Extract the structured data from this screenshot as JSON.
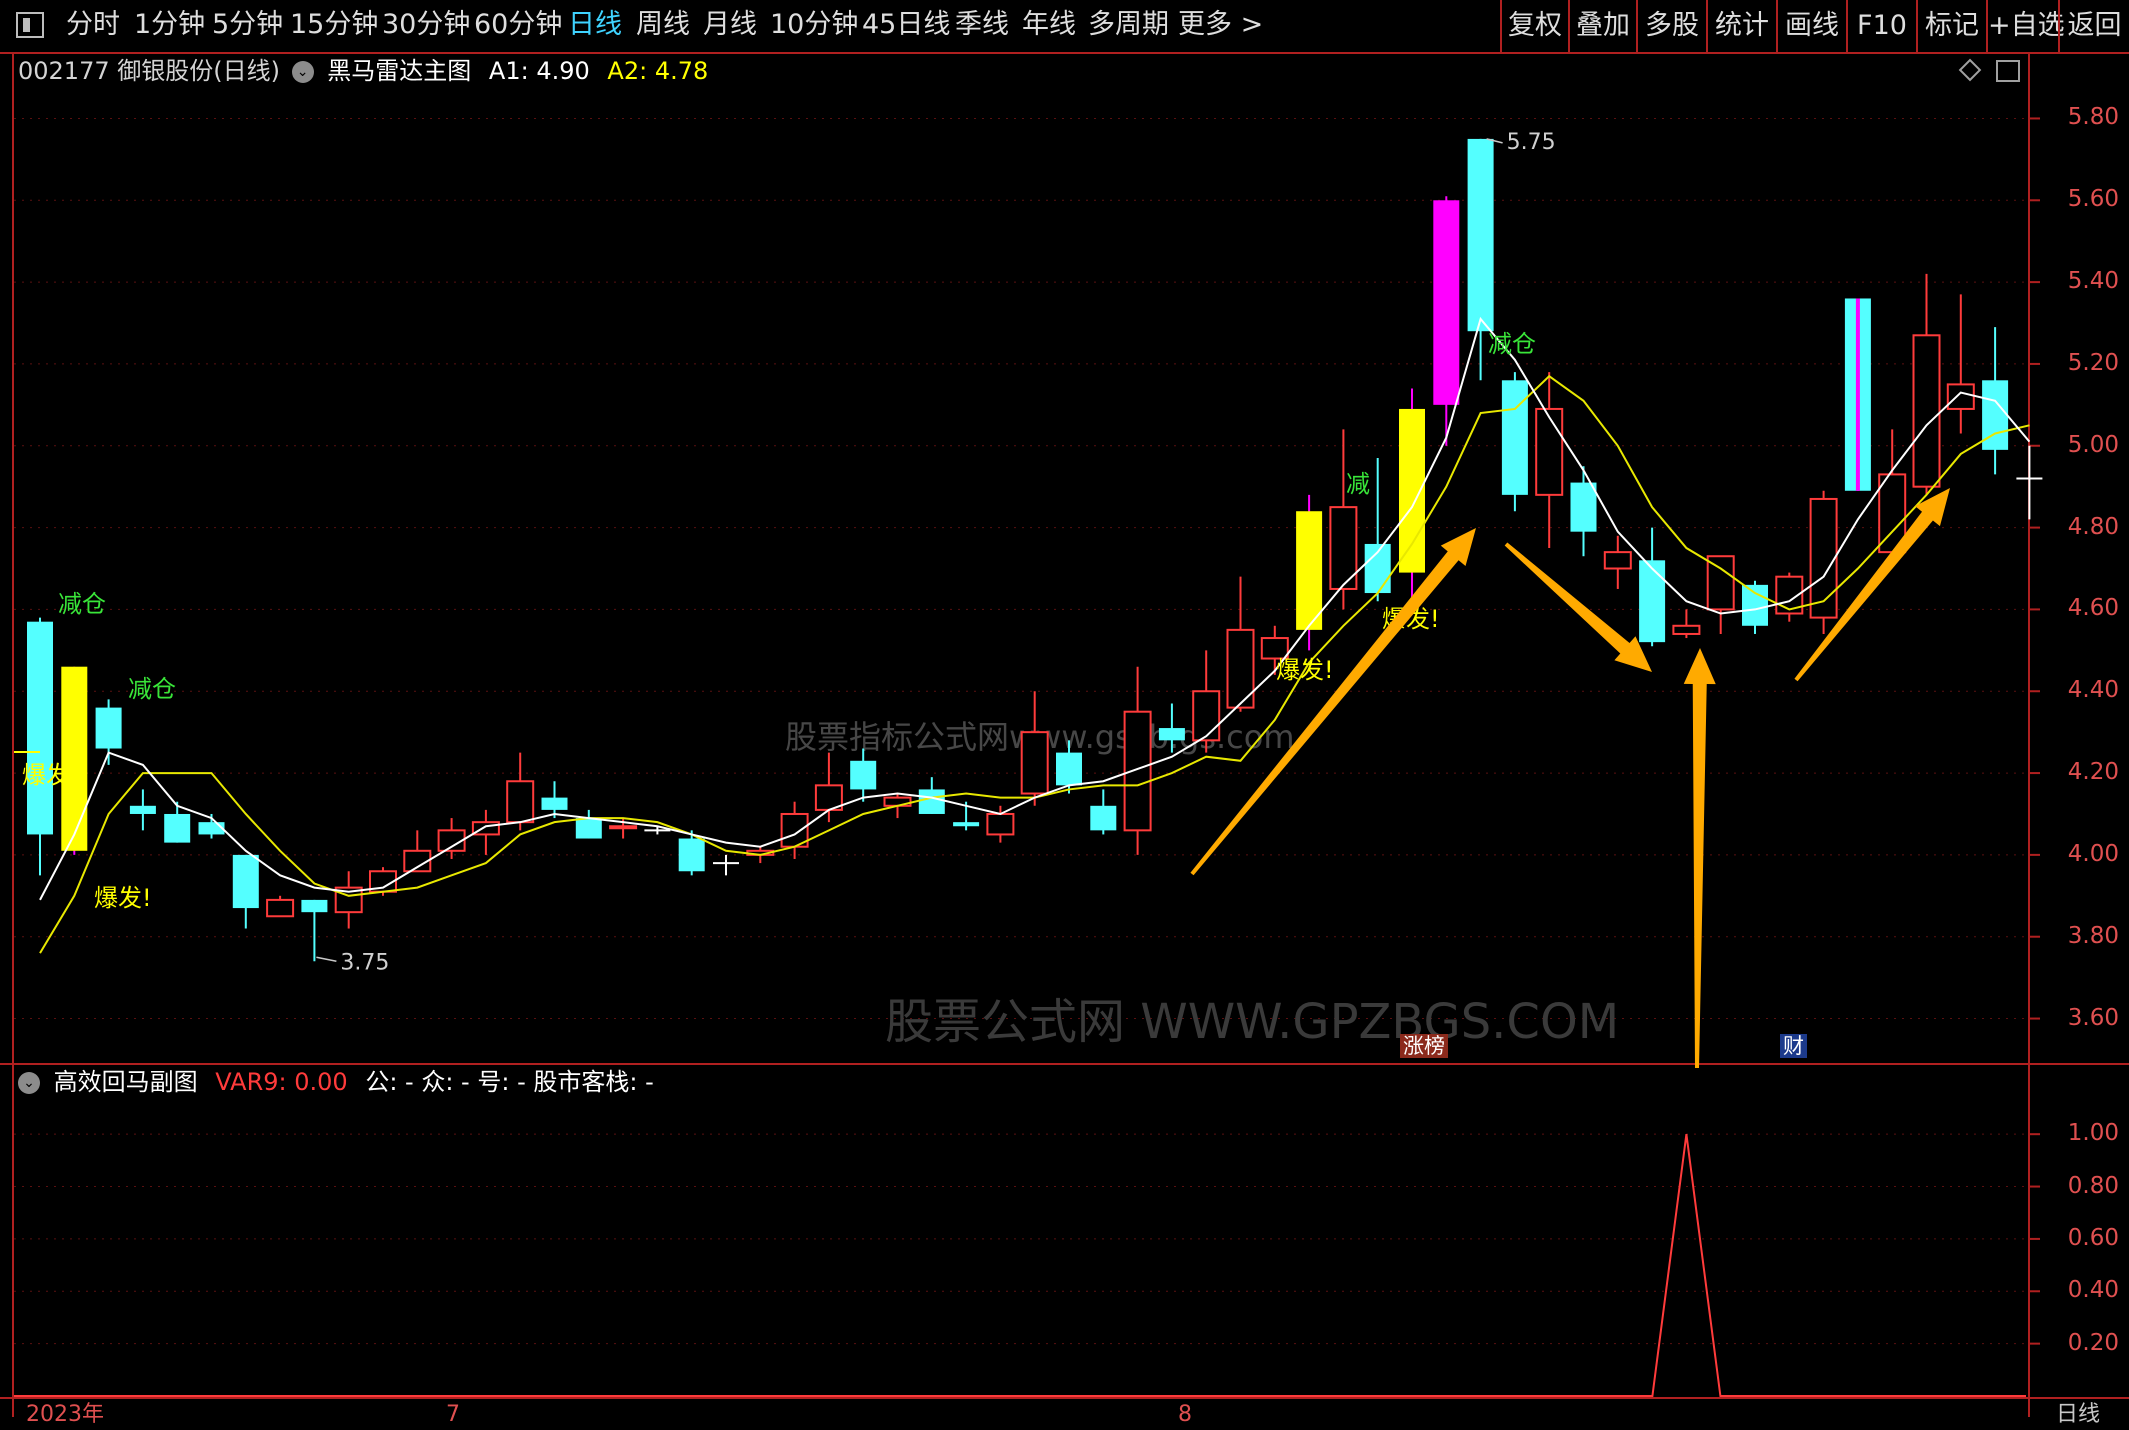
{
  "toolbar": {
    "periods": [
      "分时",
      "1分钟",
      "5分钟",
      "15分钟",
      "30分钟",
      "60分钟",
      "日线",
      "周线",
      "月线",
      "10分钟",
      "45日线",
      "季线",
      "年线",
      "多周期",
      "更多 >"
    ],
    "active_period": "日线",
    "right_tools": [
      "复权",
      "叠加",
      "多股",
      "统计",
      "画线",
      "F10",
      "标记",
      "+自选",
      "返回"
    ]
  },
  "main_panel": {
    "stock": "002177 御银股份(日线)",
    "indicator": "黑马雷达主图",
    "a1_label": "A1:",
    "a1_value": "4.90",
    "a2_label": "A2:",
    "a2_value": "4.78",
    "y_ticks": [
      "5.80",
      "5.60",
      "5.40",
      "5.20",
      "5.00",
      "4.80",
      "4.60",
      "4.40",
      "4.20",
      "4.00",
      "3.80",
      "3.60"
    ],
    "high_label": "5.75",
    "low_label": "3.75",
    "signals": {
      "reduce": "减仓",
      "reduce_short": "减",
      "burst": "爆发!"
    },
    "badges": [
      "涨榜",
      "财"
    ],
    "watermarks": {
      "big": "股票公式网 WWW.GPZBGS.COM",
      "mid": "股票指标公式网www.gszb.gs.com"
    }
  },
  "sub_panel": {
    "indicator": "高效回马副图",
    "var9_label": "VAR9:",
    "var9_value": "0.00",
    "fields": "公: -  众: -  号: -  股市客栈: -",
    "y_ticks": [
      "1.00",
      "0.80",
      "0.60",
      "0.40",
      "0.20"
    ]
  },
  "bottom": {
    "year": "2023年",
    "month_7": "7",
    "month_8": "8",
    "period_tag": "日线"
  },
  "colors": {
    "up": "#ff3b3b",
    "down": "#54ffff",
    "signal_yellow": "#ffff00",
    "signal_magenta": "#ff00ff",
    "ma_white": "#ffffff",
    "ma_yellow": "#e8e800",
    "arrow": "#ffaa00",
    "axis": "#e05050"
  },
  "chart_data": {
    "type": "candlestick",
    "title": "002177 御银股份(日线)",
    "y_range": [
      3.55,
      5.85
    ],
    "candles": [
      {
        "o": 4.05,
        "h": 4.58,
        "l": 3.95,
        "c": 4.57,
        "kind": "down"
      },
      {
        "o": 4.46,
        "h": 4.46,
        "l": 4.0,
        "c": 4.01,
        "kind": "yellow"
      },
      {
        "o": 4.36,
        "h": 4.38,
        "l": 4.22,
        "c": 4.26,
        "kind": "down"
      },
      {
        "o": 4.12,
        "h": 4.16,
        "l": 4.06,
        "c": 4.1,
        "kind": "down"
      },
      {
        "o": 4.1,
        "h": 4.13,
        "l": 4.03,
        "c": 4.03,
        "kind": "down"
      },
      {
        "o": 4.08,
        "h": 4.1,
        "l": 4.04,
        "c": 4.05,
        "kind": "down"
      },
      {
        "o": 4.0,
        "h": 4.0,
        "l": 3.82,
        "c": 3.87,
        "kind": "down"
      },
      {
        "o": 3.85,
        "h": 3.9,
        "l": 3.85,
        "c": 3.89,
        "kind": "up"
      },
      {
        "o": 3.89,
        "h": 3.89,
        "l": 3.74,
        "c": 3.86,
        "kind": "down"
      },
      {
        "o": 3.86,
        "h": 3.96,
        "l": 3.82,
        "c": 3.92,
        "kind": "up"
      },
      {
        "o": 3.91,
        "h": 3.97,
        "l": 3.9,
        "c": 3.96,
        "kind": "up"
      },
      {
        "o": 3.96,
        "h": 4.06,
        "l": 3.96,
        "c": 4.01,
        "kind": "up"
      },
      {
        "o": 4.01,
        "h": 4.09,
        "l": 3.99,
        "c": 4.06,
        "kind": "up"
      },
      {
        "o": 4.05,
        "h": 4.11,
        "l": 4.0,
        "c": 4.08,
        "kind": "up"
      },
      {
        "o": 4.08,
        "h": 4.25,
        "l": 4.06,
        "c": 4.18,
        "kind": "up"
      },
      {
        "o": 4.14,
        "h": 4.18,
        "l": 4.09,
        "c": 4.11,
        "kind": "down"
      },
      {
        "o": 4.09,
        "h": 4.11,
        "l": 4.04,
        "c": 4.04,
        "kind": "down"
      },
      {
        "o": 4.07,
        "h": 4.09,
        "l": 4.04,
        "c": 4.07,
        "kind": "up"
      },
      {
        "o": 4.06,
        "h": 4.07,
        "l": 4.05,
        "c": 4.06,
        "kind": "cross"
      },
      {
        "o": 4.04,
        "h": 4.06,
        "l": 3.95,
        "c": 3.96,
        "kind": "down"
      },
      {
        "o": 3.98,
        "h": 4.0,
        "l": 3.95,
        "c": 3.98,
        "kind": "cross"
      },
      {
        "o": 4.0,
        "h": 4.02,
        "l": 3.98,
        "c": 4.01,
        "kind": "up"
      },
      {
        "o": 4.02,
        "h": 4.13,
        "l": 3.99,
        "c": 4.1,
        "kind": "up"
      },
      {
        "o": 4.11,
        "h": 4.25,
        "l": 4.08,
        "c": 4.17,
        "kind": "up"
      },
      {
        "o": 4.23,
        "h": 4.26,
        "l": 4.13,
        "c": 4.16,
        "kind": "down"
      },
      {
        "o": 4.12,
        "h": 4.15,
        "l": 4.09,
        "c": 4.14,
        "kind": "up"
      },
      {
        "o": 4.16,
        "h": 4.19,
        "l": 4.1,
        "c": 4.1,
        "kind": "down"
      },
      {
        "o": 4.08,
        "h": 4.13,
        "l": 4.06,
        "c": 4.07,
        "kind": "down"
      },
      {
        "o": 4.05,
        "h": 4.12,
        "l": 4.03,
        "c": 4.1,
        "kind": "up"
      },
      {
        "o": 4.15,
        "h": 4.4,
        "l": 4.12,
        "c": 4.3,
        "kind": "up"
      },
      {
        "o": 4.25,
        "h": 4.28,
        "l": 4.15,
        "c": 4.17,
        "kind": "down"
      },
      {
        "o": 4.12,
        "h": 4.16,
        "l": 4.05,
        "c": 4.06,
        "kind": "down"
      },
      {
        "o": 4.06,
        "h": 4.46,
        "l": 4.0,
        "c": 4.35,
        "kind": "up"
      },
      {
        "o": 4.28,
        "h": 4.37,
        "l": 4.25,
        "c": 4.31,
        "kind": "down"
      },
      {
        "o": 4.28,
        "h": 4.5,
        "l": 4.25,
        "c": 4.4,
        "kind": "up"
      },
      {
        "o": 4.36,
        "h": 4.68,
        "l": 4.35,
        "c": 4.55,
        "kind": "up"
      },
      {
        "o": 4.48,
        "h": 4.56,
        "l": 4.44,
        "c": 4.53,
        "kind": "up"
      },
      {
        "o": 4.55,
        "h": 4.88,
        "l": 4.5,
        "c": 4.84,
        "kind": "yellow"
      },
      {
        "o": 4.65,
        "h": 5.04,
        "l": 4.6,
        "c": 4.85,
        "kind": "up"
      },
      {
        "o": 4.76,
        "h": 4.97,
        "l": 4.62,
        "c": 4.64,
        "kind": "down"
      },
      {
        "o": 4.69,
        "h": 5.14,
        "l": 4.62,
        "c": 5.09,
        "kind": "yellow"
      },
      {
        "o": 5.1,
        "h": 5.61,
        "l": 5.0,
        "c": 5.6,
        "kind": "magenta"
      },
      {
        "o": 5.28,
        "h": 5.75,
        "l": 5.16,
        "c": 5.75,
        "kind": "down"
      },
      {
        "o": 5.16,
        "h": 5.18,
        "l": 4.84,
        "c": 4.88,
        "kind": "down"
      },
      {
        "o": 4.88,
        "h": 5.18,
        "l": 4.75,
        "c": 5.09,
        "kind": "up"
      },
      {
        "o": 4.91,
        "h": 4.95,
        "l": 4.73,
        "c": 4.79,
        "kind": "down"
      },
      {
        "o": 4.7,
        "h": 4.78,
        "l": 4.65,
        "c": 4.74,
        "kind": "up"
      },
      {
        "o": 4.72,
        "h": 4.8,
        "l": 4.51,
        "c": 4.52,
        "kind": "down"
      },
      {
        "o": 4.54,
        "h": 4.6,
        "l": 4.53,
        "c": 4.56,
        "kind": "up"
      },
      {
        "o": 4.6,
        "h": 4.73,
        "l": 4.54,
        "c": 4.73,
        "kind": "up"
      },
      {
        "o": 4.66,
        "h": 4.67,
        "l": 4.54,
        "c": 4.56,
        "kind": "down"
      },
      {
        "o": 4.59,
        "h": 4.69,
        "l": 4.57,
        "c": 4.68,
        "kind": "up"
      },
      {
        "o": 4.58,
        "h": 4.89,
        "l": 4.54,
        "c": 4.87,
        "kind": "up"
      },
      {
        "o": 4.89,
        "h": 5.36,
        "l": 4.89,
        "c": 5.36,
        "kind": "magenta_thin"
      },
      {
        "o": 4.74,
        "h": 5.04,
        "l": 4.72,
        "c": 4.93,
        "kind": "up"
      },
      {
        "o": 4.9,
        "h": 5.42,
        "l": 4.88,
        "c": 5.27,
        "kind": "up"
      },
      {
        "o": 5.09,
        "h": 5.37,
        "l": 5.03,
        "c": 5.15,
        "kind": "up"
      },
      {
        "o": 5.16,
        "h": 5.29,
        "l": 4.93,
        "c": 4.99,
        "kind": "down"
      },
      {
        "o": 4.92,
        "h": 5.0,
        "l": 4.82,
        "c": 4.92,
        "kind": "cross"
      }
    ],
    "ma_white": [
      3.89,
      4.05,
      4.25,
      4.22,
      4.12,
      4.09,
      4.01,
      3.95,
      3.92,
      3.91,
      3.92,
      3.97,
      4.02,
      4.07,
      4.08,
      4.1,
      4.09,
      4.08,
      4.07,
      4.05,
      4.03,
      4.02,
      4.05,
      4.11,
      4.14,
      4.15,
      4.14,
      4.12,
      4.1,
      4.14,
      4.17,
      4.18,
      4.21,
      4.24,
      4.29,
      4.37,
      4.45,
      4.56,
      4.66,
      4.74,
      4.85,
      5.02,
      5.31,
      5.21,
      5.07,
      4.94,
      4.79,
      4.7,
      4.62,
      4.59,
      4.6,
      4.62,
      4.68,
      4.82,
      4.94,
      5.05,
      5.13,
      5.11,
      5.01
    ],
    "ma_yellow": [
      3.76,
      3.9,
      4.1,
      4.2,
      4.2,
      4.2,
      4.1,
      4.01,
      3.93,
      3.9,
      3.91,
      3.92,
      3.95,
      3.98,
      4.05,
      4.08,
      4.09,
      4.09,
      4.08,
      4.05,
      4.01,
      4.0,
      4.02,
      4.06,
      4.1,
      4.12,
      4.14,
      4.15,
      4.14,
      4.14,
      4.16,
      4.17,
      4.17,
      4.2,
      4.24,
      4.23,
      4.33,
      4.47,
      4.56,
      4.64,
      4.76,
      4.9,
      5.08,
      5.09,
      5.17,
      5.11,
      5.0,
      4.85,
      4.75,
      4.7,
      4.64,
      4.6,
      4.62,
      4.7,
      4.79,
      4.88,
      4.98,
      5.03,
      5.05
    ],
    "sub_series": {
      "name": "VAR9",
      "y_range": [
        0,
        1.1
      ],
      "spike_index": 48,
      "spike_value": 1.0
    }
  }
}
